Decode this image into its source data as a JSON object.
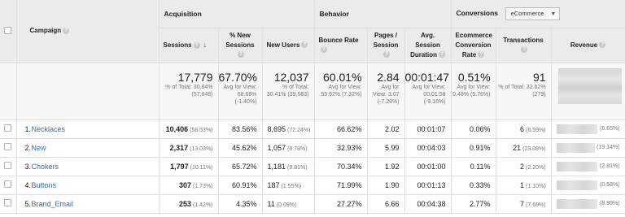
{
  "groups": {
    "acquisition": "Acquisition",
    "behavior": "Behavior",
    "conversions": "Conversions",
    "conversions_select": "eCommerce"
  },
  "columns": {
    "campaign": "Campaign",
    "sessions": "Sessions",
    "pct_new_sessions": "% New Sessions",
    "new_users": "New Users",
    "bounce_rate": "Bounce Rate",
    "pages_session": "Pages / Session",
    "avg_session_duration": "Avg. Session Duration",
    "ecommerce_conversion_rate": "Ecommerce Conversion Rate",
    "transactions": "Transactions",
    "revenue": "Revenue"
  },
  "totals": {
    "sessions": {
      "value": "17,779",
      "sub": "% of Total: 30.84% (57,648)"
    },
    "pct_new_sessions": {
      "value": "67.70%",
      "sub": "Avg for View: 68.66% (-1.40%)"
    },
    "new_users": {
      "value": "12,037",
      "sub": "% of Total: 30.41% (39,583)"
    },
    "bounce_rate": {
      "value": "60.01%",
      "sub": "Avg for View: 55.92% (7.32%)"
    },
    "pages_session": {
      "value": "2.84",
      "sub": "Avg for View: 3.07 (-7.28%)"
    },
    "avg_session_duration": {
      "value": "00:01:47",
      "sub": "Avg for View: 00:01:58 (-9.16%)"
    },
    "ecommerce_conversion_rate": {
      "value": "0.51%",
      "sub": "Avg for View: 0.48% (5.76%)"
    },
    "transactions": {
      "value": "91",
      "sub": "% of Total: 32.62% (279)"
    }
  },
  "rows": [
    {
      "index": "1.",
      "campaign": "Necklaces",
      "sessions": "10,406",
      "sessions_pct": "(58.53%)",
      "pct_new": "83.56%",
      "new_users": "8,695",
      "new_users_pct": "(72.24%)",
      "bounce": "66.62%",
      "pages": "2.02",
      "duration": "00:01:07",
      "conv_rate": "0.06%",
      "transactions": "6",
      "transactions_pct": "(6.59%)",
      "revenue_pct": "(6.65%)"
    },
    {
      "index": "2.",
      "campaign": "New",
      "sessions": "2,317",
      "sessions_pct": "(13.03%)",
      "pct_new": "45.62%",
      "new_users": "1,057",
      "new_users_pct": "(8.78%)",
      "bounce": "32.93%",
      "pages": "5.99",
      "duration": "00:04:03",
      "conv_rate": "0.91%",
      "transactions": "21",
      "transactions_pct": "(23.08%)",
      "revenue_pct": "(19.14%)"
    },
    {
      "index": "3.",
      "campaign": "Chokers",
      "sessions": "1,797",
      "sessions_pct": "(10.11%)",
      "pct_new": "65.72%",
      "new_users": "1,181",
      "new_users_pct": "(9.81%)",
      "bounce": "70.34%",
      "pages": "1.92",
      "duration": "00:01:00",
      "conv_rate": "0.11%",
      "transactions": "2",
      "transactions_pct": "(2.20%)",
      "revenue_pct": "(2.81%)"
    },
    {
      "index": "4.",
      "campaign": "Buttons",
      "sessions": "307",
      "sessions_pct": "(1.73%)",
      "pct_new": "60.91%",
      "new_users": "187",
      "new_users_pct": "(1.55%)",
      "bounce": "71.99%",
      "pages": "1.90",
      "duration": "00:01:13",
      "conv_rate": "0.33%",
      "transactions": "1",
      "transactions_pct": "(1.10%)",
      "revenue_pct": "(0.58%)"
    },
    {
      "index": "5.",
      "campaign": "Brand_Email",
      "sessions": "253",
      "sessions_pct": "(1.42%)",
      "pct_new": "4.35%",
      "new_users": "11",
      "new_users_pct": "(0.09%)",
      "bounce": "27.27%",
      "pages": "6.66",
      "duration": "00:04:38",
      "conv_rate": "2.77%",
      "transactions": "7",
      "transactions_pct": "(7.69%)",
      "revenue_pct": "(8.99%)"
    }
  ]
}
